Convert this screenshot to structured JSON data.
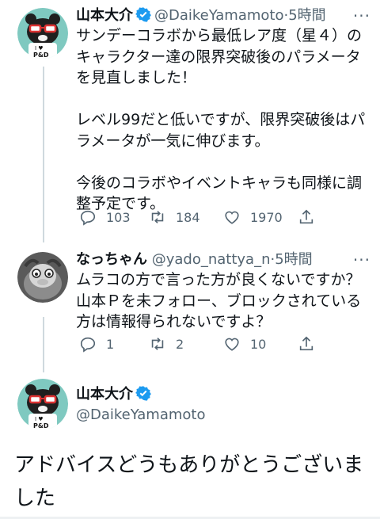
{
  "tweets": [
    {
      "name": "山本大介",
      "handle": "@DaikeYamamoto",
      "separator": "·",
      "time": "5時間",
      "text": "サンデーコラボから最低レア度（星４）のキャラクター達の限界突破後のパラメータを見直しました！\n\nレベル99だと低いですが、限界突破後はパラメータが一気に伸びます。\n\n今後のコラボやイベントキャラも同様に調整予定です。",
      "replies": "103",
      "retweets": "184",
      "likes": "1970",
      "verified": true
    },
    {
      "name": "なっちゃん",
      "handle": "@yado_nattya_n",
      "separator": "·",
      "time": "5時間",
      "text": "ムラコの方で言った方が良くないですか？山本Ｐを未フォロー、ブロックされている方は情報得られないですよ？",
      "replies": "1",
      "retweets": "2",
      "likes": "10",
      "verified": false
    }
  ],
  "focused": {
    "name": "山本大介",
    "handle": "@DaikeYamamoto",
    "text": "アドバイスどうもありがとうございました",
    "verified": true
  },
  "more_glyph": "···",
  "avatar_badge": "P&D",
  "avatar_heart": "I ♥",
  "colors": {
    "verified": "#1d9bf0",
    "secondary": "#536471",
    "avatar_bg": "#7fc9c0",
    "line": "#cfd9de"
  },
  "icons": [
    "reply-icon",
    "retweet-icon",
    "like-icon",
    "share-icon",
    "verified-icon",
    "more-icon"
  ]
}
